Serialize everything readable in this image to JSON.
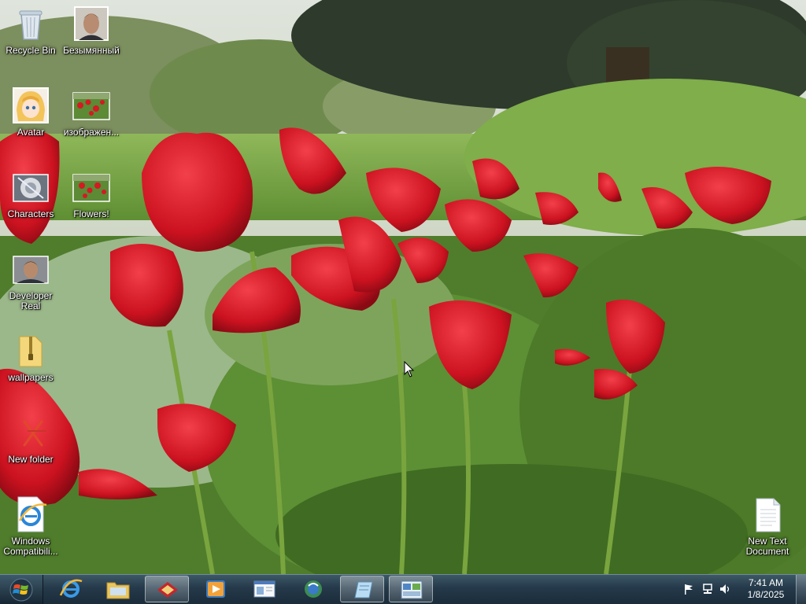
{
  "desktop": {
    "icons": [
      {
        "label": "Recycle Bin",
        "icon": "recycle-bin-icon"
      },
      {
        "label": "Безымянный",
        "icon": "photo-icon"
      },
      {
        "label": "Avatar",
        "icon": "anime-avatar-icon"
      },
      {
        "label": "изображен...",
        "icon": "flowers-photo-icon"
      },
      {
        "label": "Characters",
        "icon": "characters-icon"
      },
      {
        "label": "Flowers!",
        "icon": "flowers-photo-icon"
      },
      {
        "label": "Developer Real",
        "icon": "photo-icon"
      },
      {
        "label": "wallpapers",
        "icon": "zip-folder-icon"
      },
      {
        "label": "New folder",
        "icon": "folder-icon"
      },
      {
        "label": "Windows Compatibili...",
        "icon": "internet-explorer-icon"
      },
      {
        "label": "New Text Document",
        "icon": "text-document-icon"
      }
    ]
  },
  "taskbar": {
    "start_icon": "windows-logo-icon",
    "pinned": [
      {
        "icon": "internet-explorer-icon",
        "active": false
      },
      {
        "icon": "file-explorer-icon",
        "active": false
      },
      {
        "icon": "app-red-icon",
        "active": true
      },
      {
        "icon": "media-player-icon",
        "active": false
      },
      {
        "icon": "window-app-icon",
        "active": false
      },
      {
        "icon": "globe-app-icon",
        "active": false
      },
      {
        "icon": "notepad-icon",
        "active": true
      },
      {
        "icon": "control-panel-icon",
        "active": true
      }
    ],
    "tray": {
      "icons": [
        "action-center-flag-icon",
        "network-icon",
        "volume-icon"
      ],
      "time": "7:41 AM",
      "date": "1/8/2025"
    }
  },
  "colors": {
    "taskbar": "#24394a",
    "tulip": "#d21421",
    "foliage": "#6ea044"
  }
}
